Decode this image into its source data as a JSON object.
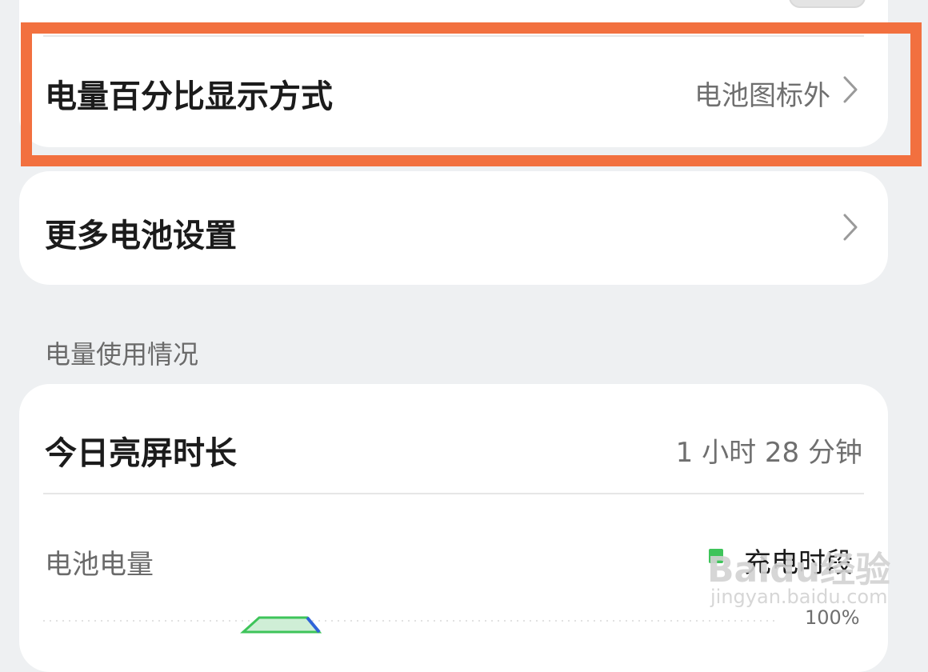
{
  "colors": {
    "background": "#eef0f2",
    "card": "#ffffff",
    "highlight_border": "#f2703f",
    "legend_green": "#3ec45a",
    "chart_blue": "#2f63d8"
  },
  "top_card": {
    "percent_display_row": {
      "title": "电量百分比显示方式",
      "value": "电池图标外",
      "chevron_icon": "chevron-right-icon"
    }
  },
  "more_settings_card": {
    "title": "更多电池设置",
    "chevron_icon": "chevron-right-icon"
  },
  "usage_section": {
    "label": "电量使用情况",
    "screen_time": {
      "title": "今日亮屏时长",
      "value": "1 小时 28 分钟"
    },
    "battery_level": {
      "label": "电池电量",
      "legend_label": "充电时段",
      "axis_max_label": "100%"
    }
  },
  "watermark": {
    "logo": "Baidu经验",
    "url": "jingyan.baidu.com"
  }
}
